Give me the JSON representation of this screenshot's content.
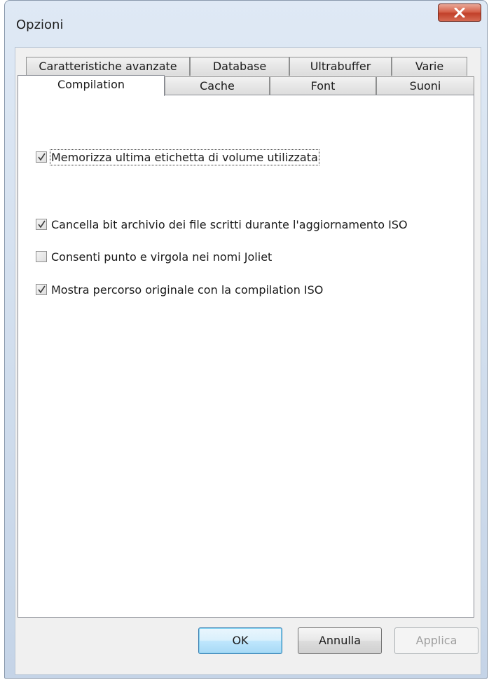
{
  "window": {
    "title": "Opzioni"
  },
  "tabs": {
    "back_row": [
      {
        "label": "Caratteristiche avanzate"
      },
      {
        "label": "Database"
      },
      {
        "label": "Ultrabuffer"
      },
      {
        "label": "Varie"
      }
    ],
    "front_row": [
      {
        "label": "Compilation",
        "active": true
      },
      {
        "label": "Cache"
      },
      {
        "label": "Font"
      },
      {
        "label": "Suoni"
      }
    ]
  },
  "options": [
    {
      "label": "Memorizza ultima etichetta di volume utilizzata",
      "checked": true,
      "focused": true
    },
    {
      "label": "Cancella bit archivio dei file scritti durante l'aggiornamento ISO",
      "checked": true
    },
    {
      "label": "Consenti punto e virgola nei nomi Joliet",
      "checked": false
    },
    {
      "label": "Mostra percorso originale con la compilation ISO",
      "checked": true
    }
  ],
  "buttons": {
    "ok": "OK",
    "cancel": "Annulla",
    "apply": "Applica"
  },
  "colors": {
    "title_bar": "#cfdcec",
    "close_button": "#c1402a",
    "default_button_border": "#3c7fb1"
  }
}
